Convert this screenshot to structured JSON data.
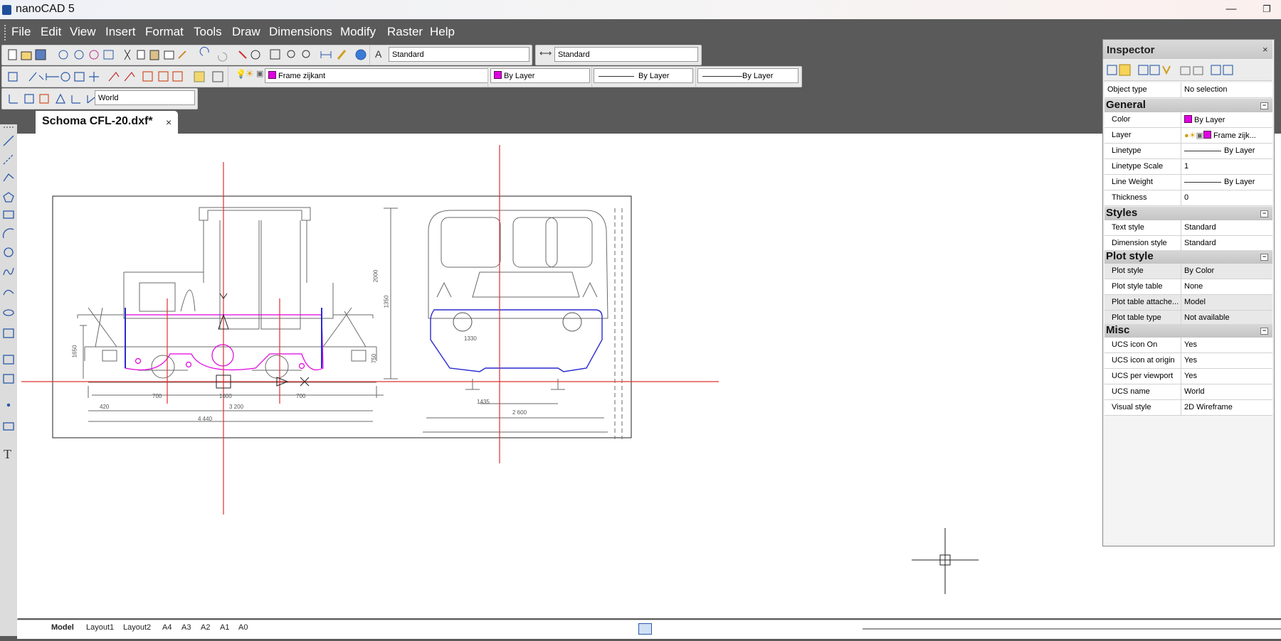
{
  "window": {
    "title": "nanoCAD 5",
    "minimize": "—",
    "restore": "❐"
  },
  "menu": [
    "File",
    "Edit",
    "View",
    "Insert",
    "Format",
    "Tools",
    "Draw",
    "Dimensions",
    "Modify",
    "Raster",
    "Help"
  ],
  "toolbar": {
    "text_style": "Standard",
    "dim_style": "Standard",
    "layer": "Frame zijkant",
    "color": "By Layer",
    "linetype": "By Layer",
    "lineweight": "By Layer",
    "ucs": "World"
  },
  "document": {
    "tab_label": "Schoma CFL-20.dxf*",
    "close": "×"
  },
  "layout_tabs": [
    "Model",
    "Layout1",
    "Layout2",
    "A4",
    "A3",
    "A2",
    "A1",
    "A0"
  ],
  "inspector": {
    "title": "Inspector",
    "close": "×",
    "object_type": {
      "name": "Object type",
      "value": "No selection"
    },
    "sections": [
      {
        "title": "General",
        "rows": [
          {
            "name": "Color",
            "value": "By Layer"
          },
          {
            "name": "Layer",
            "value": "Frame zijk..."
          },
          {
            "name": "Linetype",
            "value": "By Layer"
          },
          {
            "name": "Linetype Scale",
            "value": "1"
          },
          {
            "name": "Line Weight",
            "value": "By Layer"
          },
          {
            "name": "Thickness",
            "value": "0"
          }
        ]
      },
      {
        "title": "Styles",
        "rows": [
          {
            "name": "Text style",
            "value": "Standard"
          },
          {
            "name": "Dimension style",
            "value": "Standard"
          }
        ]
      },
      {
        "title": "Plot style",
        "rows": [
          {
            "name": "Plot style",
            "value": "By Color"
          },
          {
            "name": "Plot style table",
            "value": "None"
          },
          {
            "name": "Plot table attache...",
            "value": "Model"
          },
          {
            "name": "Plot table type",
            "value": "Not available"
          }
        ]
      },
      {
        "title": "Misc",
        "rows": [
          {
            "name": "UCS icon On",
            "value": "Yes"
          },
          {
            "name": "UCS icon at origin",
            "value": "Yes"
          },
          {
            "name": "UCS per viewport",
            "value": "Yes"
          },
          {
            "name": "UCS name",
            "value": "World"
          },
          {
            "name": "Visual style",
            "value": "2D Wireframe"
          }
        ]
      }
    ]
  },
  "drawing": {
    "side_dims": [
      "700",
      "1600",
      "700",
      "420",
      "3 200",
      "4 440"
    ],
    "front_dims": [
      "1330",
      "1435",
      "2 600"
    ],
    "height_dims": [
      "2000",
      "1350",
      "750",
      "1650"
    ]
  },
  "colors": {
    "accent_red": "#e03030",
    "selection_blue": "#2a2ad0",
    "layer_magenta": "#e000e0",
    "ui_dark": "#5a5a5a"
  }
}
